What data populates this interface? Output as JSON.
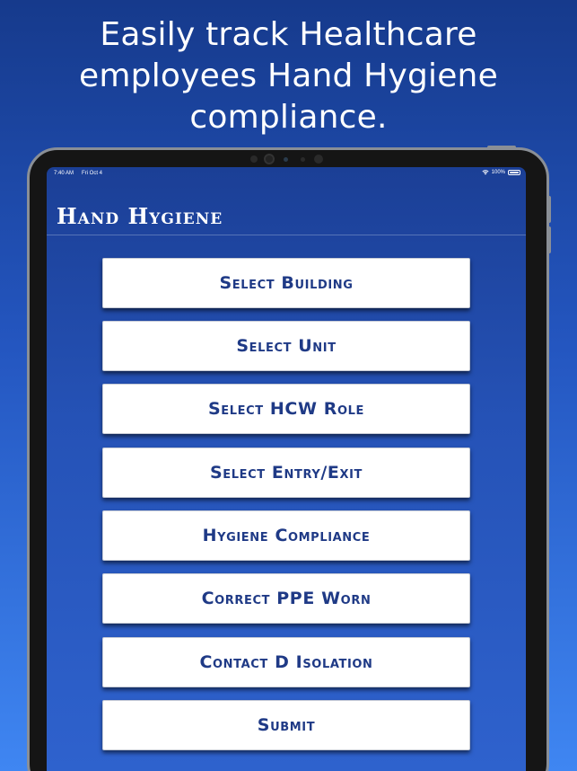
{
  "headline": {
    "line1": "Easily track Healthcare",
    "line2": "employees Hand Hygiene",
    "line3": "compliance."
  },
  "status_bar": {
    "time": "7:40 AM",
    "date": "Fri Oct 4",
    "battery": "100%",
    "icons": [
      "wifi-icon",
      "battery-icon"
    ]
  },
  "app": {
    "title": "Hand Hygiene"
  },
  "buttons": [
    {
      "label": "Select Building"
    },
    {
      "label": "Select Unit"
    },
    {
      "label": "Select HCW Role"
    },
    {
      "label": "Select Entry/Exit"
    },
    {
      "label": "Hygiene Compliance"
    },
    {
      "label": "Correct PPE Worn"
    },
    {
      "label": "Contact D Isolation"
    },
    {
      "label": "Submit"
    }
  ],
  "colors": {
    "background_top": "#163a8c",
    "background_bottom": "#3f86f2",
    "button_text": "#1f3a86",
    "button_bg": "#ffffff"
  }
}
